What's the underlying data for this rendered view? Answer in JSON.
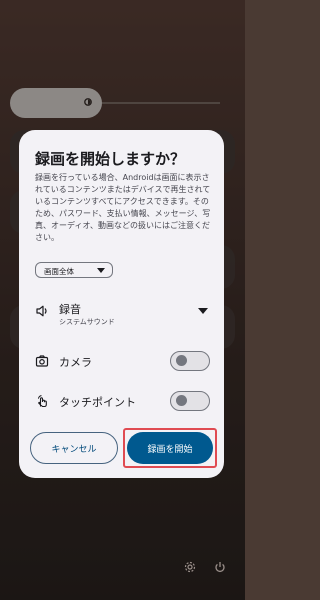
{
  "dialog": {
    "title": "録画を開始しますか？",
    "description": "録画を行っている場合、Androidは画面に表示されているコンテンツまたはデバイスで再生されているコンテンツすべてにアクセスできます。そのため、パスワード、支払い情報、メッセージ、写真、オーディオ、動画などの扱いにはご注意ください。",
    "scope_select": {
      "selected": "画面全体"
    },
    "audio": {
      "label": "録音",
      "sublabel": "システムサウンド"
    },
    "camera": {
      "label": "カメラ",
      "enabled": false
    },
    "touches": {
      "label": "タッチポイント",
      "enabled": false
    },
    "buttons": {
      "cancel": "キャンセル",
      "start": "録画を開始"
    }
  },
  "colors": {
    "primary": "#00598f",
    "highlight": "#e04b52",
    "dialog_bg": "#f3f2f6"
  },
  "icons": [
    "speaker-icon",
    "camera-icon",
    "touch-icon",
    "brightness-icon",
    "settings-icon",
    "power-icon"
  ]
}
